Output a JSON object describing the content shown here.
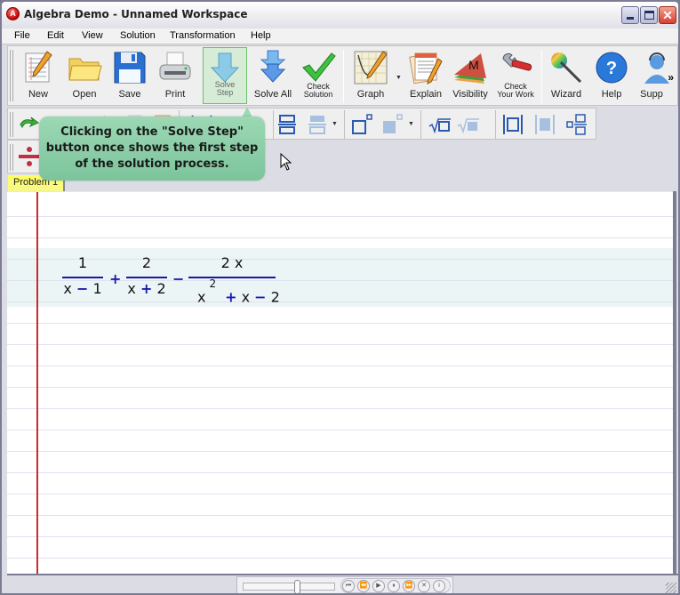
{
  "window": {
    "title": "Algebra Demo - Unnamed Workspace",
    "app_icon_letter": "A",
    "controls": {
      "minimize": "",
      "maximize": "",
      "close": "✕"
    }
  },
  "menubar": {
    "items": [
      "File",
      "Edit",
      "View",
      "Solution",
      "Transformation",
      "Help"
    ]
  },
  "toolbar": {
    "buttons": [
      {
        "label": "New",
        "icon": "new-document-icon"
      },
      {
        "label": "Open",
        "icon": "folder-open-icon"
      },
      {
        "label": "Save",
        "icon": "floppy-disk-icon"
      },
      {
        "label": "Print",
        "icon": "printer-icon"
      },
      {
        "label": "Solve Step",
        "label_line1": "Solve",
        "label_line2": "Step",
        "icon": "solve-step-arrow-icon",
        "active": true
      },
      {
        "label": "Solve All",
        "icon": "solve-all-arrows-icon"
      },
      {
        "label": "Check Solution",
        "label_line1": "Check",
        "label_line2": "Solution",
        "icon": "checkmark-icon"
      },
      {
        "label": "Graph",
        "icon": "graph-icon",
        "has_dropdown": true
      },
      {
        "label": "Explain",
        "icon": "explain-notes-icon"
      },
      {
        "label": "Visibility",
        "icon": "visibility-layers-icon",
        "icon_letter": "M"
      },
      {
        "label": "Check Your Work",
        "label_line1": "Check",
        "label_line2": "Your Work",
        "icon": "wrench-icon"
      },
      {
        "label": "Wizard",
        "icon": "magic-wand-icon"
      },
      {
        "label": "Help",
        "icon": "help-question-icon",
        "icon_letter": "?"
      },
      {
        "label": "Supp",
        "icon": "support-person-icon"
      }
    ],
    "overflow": "»"
  },
  "formatting_toolbar": {
    "buttons": [
      "undo-icon",
      "redo-icon",
      "cut-icon",
      "copy-icon",
      "paste-icon",
      "paren-left-icon",
      "paren-right-icon",
      "paren-small-icon",
      "fraction-stack-icon",
      "fraction-stack-light-icon",
      "superscript-box-icon",
      "superscript-filled-icon",
      "sqrt-icon",
      "sqrt-light-icon",
      "abs-value-icon",
      "abs-value-light-icon",
      "mixed-fraction-icon"
    ]
  },
  "tertiary_toolbar": {
    "buttons": [
      "divide-icon"
    ]
  },
  "callout": {
    "text": "Clicking on the \"Solve Step\" button once shows the first step of the solution process."
  },
  "tabs": [
    {
      "label": "Problem 1",
      "active": true
    }
  ],
  "expression": {
    "term1": {
      "numerator": "1",
      "denominator_var": "x",
      "denominator_op": "−",
      "denominator_const": "1"
    },
    "op1": "+",
    "term2": {
      "numerator": "2",
      "denominator_var": "x",
      "denominator_op": "+",
      "denominator_const": "2"
    },
    "op2": "−",
    "term3": {
      "numerator": "2 x",
      "den_base": "x",
      "den_exp": "2",
      "den_op1": "+",
      "den_var": "x",
      "den_op2": "−",
      "den_const": "2"
    }
  },
  "player": {
    "slider_position": 0.58,
    "buttons": [
      {
        "name": "first",
        "glyph": "⏮"
      },
      {
        "name": "rewind",
        "glyph": "⏪"
      },
      {
        "name": "play",
        "glyph": "▶"
      },
      {
        "name": "pause",
        "glyph": "⏸"
      },
      {
        "name": "fast-forward",
        "glyph": "⏩"
      },
      {
        "name": "stop",
        "glyph": "✕"
      },
      {
        "name": "info",
        "glyph": "i"
      }
    ]
  },
  "colors": {
    "accent_green": "#7cc49c",
    "margin_red": "#cc2a2a",
    "operator_blue": "#1a1ab4",
    "tab_yellow": "#ffff60"
  }
}
